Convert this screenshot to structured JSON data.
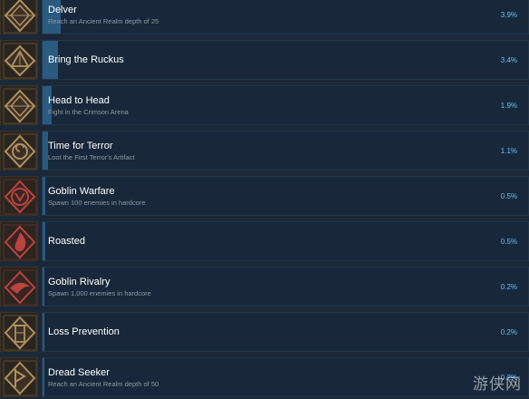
{
  "achievements": [
    {
      "title": "Delver",
      "description": "Reach an Ancient Realm depth of 25",
      "percent": "3.9%",
      "unlock_rate": 3.9,
      "icon": "diamond-emblem-icon",
      "icon_color": "#b09060"
    },
    {
      "title": "Bring the Ruckus",
      "description": "",
      "percent": "3.4%",
      "unlock_rate": 3.4,
      "icon": "pyramid-emblem-icon",
      "icon_color": "#b09060"
    },
    {
      "title": "Head to Head",
      "description": "Fight in the Crimson Arena",
      "percent": "1.9%",
      "unlock_rate": 1.9,
      "icon": "diamond-emblem-icon",
      "icon_color": "#b09060"
    },
    {
      "title": "Time for Terror",
      "description": "Loot the First Terror's Artifact",
      "percent": "1.1%",
      "unlock_rate": 1.1,
      "icon": "spiral-emblem-icon",
      "icon_color": "#b09060"
    },
    {
      "title": "Goblin Warfare",
      "description": "Spawn 100 enemies in hardcore",
      "percent": "0.5%",
      "unlock_rate": 0.5,
      "icon": "red-rune-icon",
      "icon_color": "#b8453e"
    },
    {
      "title": "Roasted",
      "description": "",
      "percent": "0.5%",
      "unlock_rate": 0.5,
      "icon": "red-flame-icon",
      "icon_color": "#b8453e"
    },
    {
      "title": "Goblin Rivalry",
      "description": "Spawn 1,000 enemies in hardcore",
      "percent": "0.2%",
      "unlock_rate": 0.2,
      "icon": "red-bird-icon",
      "icon_color": "#b8453e"
    },
    {
      "title": "Loss Prevention",
      "description": "",
      "percent": "0.2%",
      "unlock_rate": 0.2,
      "icon": "tower-emblem-icon",
      "icon_color": "#b09060"
    },
    {
      "title": "Dread Seeker",
      "description": "Reach an Ancient Realm depth of 50",
      "percent": "0.2%",
      "unlock_rate": 0.2,
      "icon": "rune-emblem-icon",
      "icon_color": "#b09060"
    }
  ],
  "watermark": "游侠网"
}
